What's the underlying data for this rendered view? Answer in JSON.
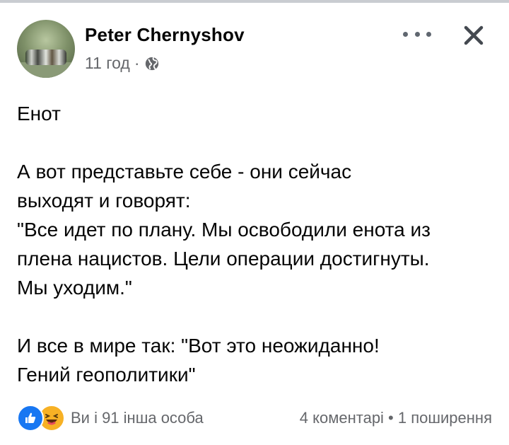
{
  "post": {
    "author": "Peter Chernyshov",
    "time": "11 год",
    "dot": "·",
    "body": "Енот\n\nА вот представьте себе - они сейчас\nвыходят и говорят:\n\"Все идет по плану. Мы освободили енота из\nплена нацистов. Цели операции достигнуты.\nМы уходим.\"\n\nИ все в мире так: \"Вот это неожиданно!\nГений геополитики\""
  },
  "footer": {
    "reactions_text": "Ви і 91 інша особа",
    "stats_text": "4 коментарі • 1 поширення",
    "reaction_icons": [
      "like-icon",
      "haha-icon"
    ]
  },
  "colors": {
    "like": "#1877f2",
    "haha": "#f7b125",
    "meta": "#65676b"
  }
}
